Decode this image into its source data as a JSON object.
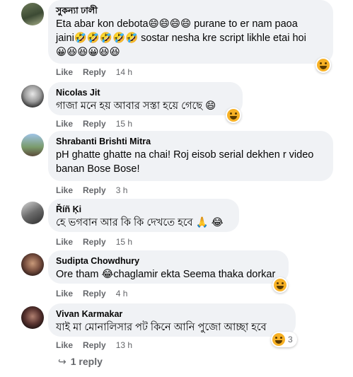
{
  "colors": {
    "bubble_bg": "#f0f2f5",
    "meta_text": "#65676b",
    "reaction_face": "#f7b125"
  },
  "action_labels": {
    "like": "Like",
    "reply": "Reply"
  },
  "comments": [
    {
      "author": "সুকন্যা ঢালী",
      "lines": [
        "Eta abar kon debota😄😄😄😄 purane to er nam paoa",
        "jaini🤣🤣🤣🤣🤣 sostar nesha kre script likhle etai hoi",
        "😀😆😆😀😆😆"
      ],
      "time": "14 h",
      "reaction_icon": "haha-reaction-icon"
    },
    {
      "author": "Nicolas Jit",
      "lines": [
        "গাজা মনে হয় আবার সস্তা হয়ে গেছে 😄"
      ],
      "time": "15 h",
      "reaction_icon": "haha-reaction-icon"
    },
    {
      "author": "Shrabanti Brishti Mitra",
      "lines": [
        "pH ghatte ghatte na chai! Roj eisob serial dekhen r video",
        "banan Bose Bose!"
      ],
      "time": "3 h"
    },
    {
      "author": "Říñ Ķi",
      "lines": [
        "হে ভগবান আর কি কি দেখতে হবে 🙏 😂"
      ],
      "time": "15 h"
    },
    {
      "author": "Sudipta Chowdhury",
      "lines": [
        "Ore tham 😂chaglamir ekta Seema thaka dorkar"
      ],
      "time": "4 h",
      "reaction_icon": "haha-reaction-icon"
    },
    {
      "author": "Vivan Karmakar",
      "lines": [
        "যাই মা মোনালিসার পট কিনে আনি পুজো আচ্ছা হবে"
      ],
      "time": "13 h",
      "reaction_icon": "haha-reaction-icon",
      "reaction_count": "3"
    }
  ],
  "replies_link": {
    "arrow": "↪",
    "label": "1 reply"
  }
}
